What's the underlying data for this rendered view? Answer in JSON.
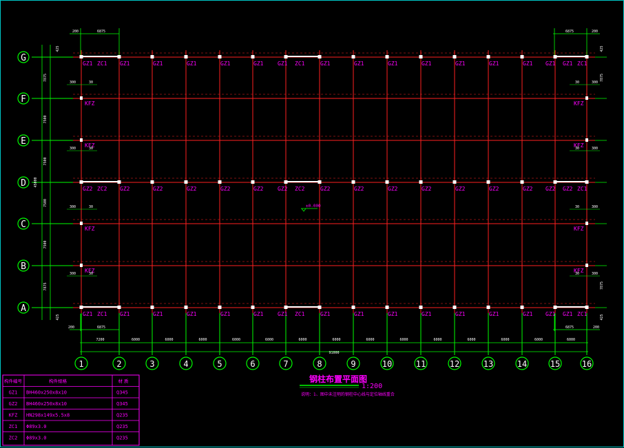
{
  "colors": {
    "background": "#000000",
    "axis_line": "#ff2020",
    "column_line": "#00ff00",
    "label_magenta": "#ff00ff",
    "bubble": "#00ff00",
    "text_white": "#ffffff",
    "dimension": "#00ff00",
    "table_line": "#ff00ff"
  },
  "row_axes": [
    "G",
    "F",
    "E",
    "D",
    "C",
    "B",
    "A"
  ],
  "column_axes": [
    "1",
    "2",
    "3",
    "4",
    "5",
    "6",
    "7",
    "8",
    "9",
    "10",
    "11",
    "12",
    "13",
    "14",
    "15",
    "16"
  ],
  "column_spacings": [
    "7200",
    "6000",
    "6000",
    "6000",
    "6000",
    "6000",
    "6000",
    "6000",
    "6000",
    "6000",
    "6000",
    "6000",
    "6000",
    "6000",
    "6000"
  ],
  "total_length": "91000",
  "row_spacings": [
    "7875",
    "7500",
    "7500",
    "7500",
    "7500",
    "7875"
  ],
  "total_width": "45000",
  "top_dims": {
    "left_a": "200",
    "left_b": "6875",
    "right_b": "6875",
    "right_a": "200"
  },
  "bottom_dims": {
    "left_a": "200",
    "left_b": "6875",
    "right_b": "6875",
    "right_a": "200"
  },
  "edge_dims": {
    "top": "425",
    "bottom": "425",
    "small": "300",
    "tiny": "30"
  },
  "row_labels": {
    "G": [
      "GZ1",
      "ZC1",
      "GZ1",
      "GZ1",
      "GZ1",
      "GZ1",
      "GZ1",
      "GZ1",
      "ZC1",
      "GZ1",
      "GZ1",
      "GZ1",
      "GZ1",
      "GZ1",
      "GZ1",
      "GZ1",
      "GZ1",
      "GZ1",
      "ZC1",
      "GZ1"
    ],
    "D": [
      "GZ2",
      "ZC2",
      "GZ2",
      "GZ2",
      "GZ2",
      "GZ2",
      "GZ2",
      "GZ2",
      "ZC2",
      "GZ2",
      "GZ2",
      "GZ2",
      "GZ2",
      "GZ2",
      "GZ2",
      "GZ2",
      "GZ2",
      "GZ2",
      "ZC1",
      "GZ2"
    ],
    "A": [
      "GZ1",
      "ZC1",
      "GZ1",
      "GZ1",
      "GZ1",
      "GZ1",
      "GZ1",
      "GZ1",
      "ZC1",
      "GZ1",
      "GZ1",
      "GZ1",
      "GZ1",
      "GZ1",
      "GZ1",
      "GZ1",
      "GZ1",
      "GZ1",
      "ZC1",
      "GZ1"
    ]
  },
  "kfz_label": "KFZ",
  "elevation": "±0.000",
  "drawing_title": "钢柱布置平面图",
  "drawing_scale": "1:200",
  "drawing_note": "说明：1、图中未注明的钢柱中心线与定位轴线重合",
  "table": {
    "headers": [
      "构件编号",
      "构件规格",
      "材 质"
    ],
    "rows": [
      [
        "GZ1",
        "BH460x250x8x10",
        "Q345"
      ],
      [
        "GZ2",
        "BH460x250x8x10",
        "Q345"
      ],
      [
        "KFZ",
        "HN298x149x5.5x8",
        "Q235"
      ],
      [
        "ZC1",
        "Φ89x3.0",
        "Q235"
      ],
      [
        "ZC2",
        "Φ89x3.0",
        "Q235"
      ]
    ]
  }
}
